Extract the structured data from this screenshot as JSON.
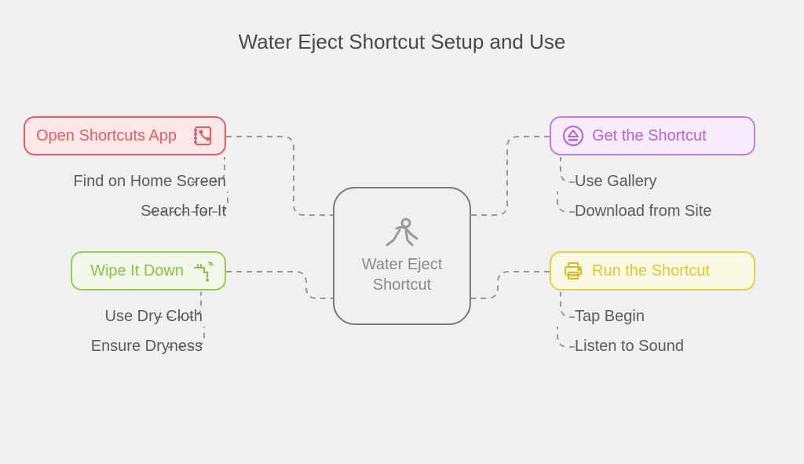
{
  "title": "Water Eject Shortcut Setup and Use",
  "center": {
    "label": "Water Eject\nShortcut"
  },
  "nodes": {
    "top_left": {
      "label": "Open Shortcuts App",
      "items": [
        "Find on Home Screen",
        "Search for It"
      ]
    },
    "top_right": {
      "label": "Get the Shortcut",
      "items": [
        "Use Gallery",
        "Download from Site"
      ]
    },
    "bottom_left": {
      "label": "Wipe It Down",
      "items": [
        "Use Dry Cloth",
        "Ensure Dryness"
      ]
    },
    "bottom_right": {
      "label": "Run the Shortcut",
      "items": [
        "Tap Begin",
        "Listen to Sound"
      ]
    }
  }
}
